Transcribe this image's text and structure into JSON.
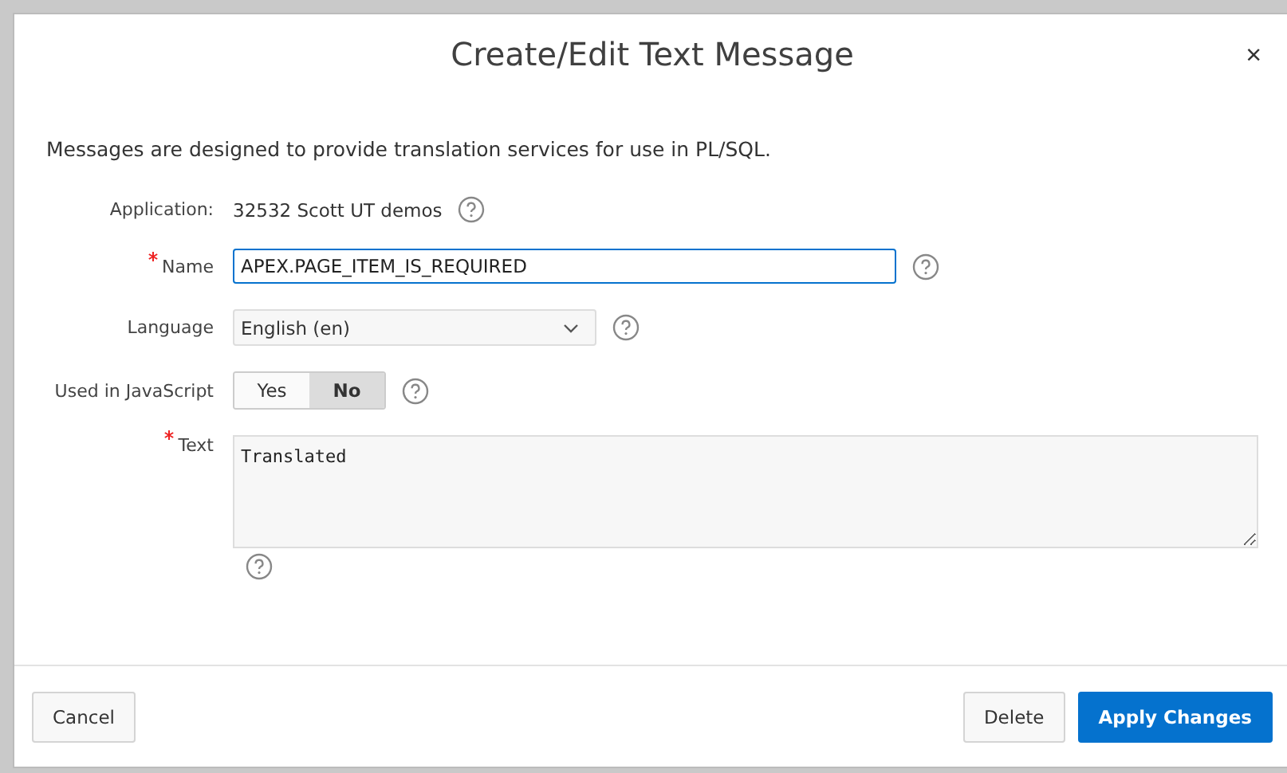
{
  "dialog": {
    "title": "Create/Edit Text Message",
    "close": "×"
  },
  "description": "Messages are designed to provide translation services for use in PL/SQL.",
  "form": {
    "application": {
      "label": "Application:",
      "value": "32532 Scott UT demos"
    },
    "name": {
      "label": "Name",
      "required": true,
      "value": "APEX.PAGE_ITEM_IS_REQUIRED"
    },
    "language": {
      "label": "Language",
      "value": "English (en)"
    },
    "used_in_javascript": {
      "label": "Used in JavaScript",
      "options": [
        {
          "label": "Yes",
          "selected": false
        },
        {
          "label": "No",
          "selected": true
        }
      ]
    },
    "text": {
      "label": "Text",
      "required": true,
      "value": "Translated"
    }
  },
  "footer_left_buttons": [
    {
      "label": "Cancel"
    }
  ],
  "footer_right_buttons": [
    {
      "label": "Delete",
      "kind": "default"
    },
    {
      "label": "Apply Changes",
      "kind": "primary"
    }
  ]
}
